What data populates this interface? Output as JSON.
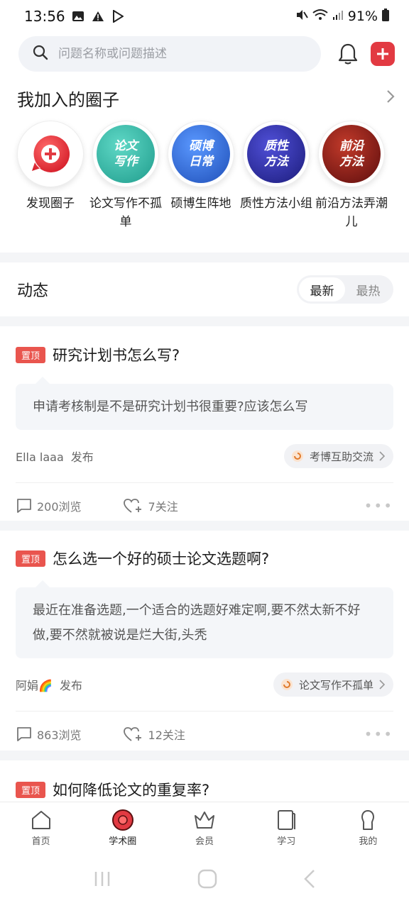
{
  "status_bar": {
    "time": "13:56",
    "battery": "91%"
  },
  "search": {
    "placeholder": "问题名称或问题描述"
  },
  "circles": {
    "title": "我加入的圈子",
    "items": [
      {
        "label": "发现圈子",
        "avatar_text": ""
      },
      {
        "label": "论文写作不孤单",
        "avatar_text": "论文写作",
        "color": "#2fb5a5"
      },
      {
        "label": "硕博生阵地",
        "avatar_text": "硕博日常",
        "color": "#2f6fd6"
      },
      {
        "label": "质性方法小组",
        "avatar_text": "质性方法",
        "color": "#2a2aa0"
      },
      {
        "label": "前沿方法弄潮儿",
        "avatar_text": "前沿方法",
        "color": "#8b1a1a"
      }
    ]
  },
  "feed": {
    "title": "动态",
    "tabs": [
      {
        "label": "最新",
        "active": true
      },
      {
        "label": "最热",
        "active": false
      }
    ],
    "posts": [
      {
        "pinned_label": "置顶",
        "title": "研究计划书怎么写?",
        "desc": "申请考核制是不是研究计划书很重要?应该怎么写",
        "author": "Ella laaa",
        "verb": "发布",
        "circle": "考博互助交流",
        "views": "200浏览",
        "follows": "7关注"
      },
      {
        "pinned_label": "置顶",
        "title": "怎么选一个好的硕士论文选题啊?",
        "desc": "最近在准备选题,一个适合的选题好难定啊,要不然太新不好做,要不然就被说是烂大街,头秃",
        "author": "阿娟🌈",
        "verb": "发布",
        "circle": "论文写作不孤单",
        "views": "863浏览",
        "follows": "12关注"
      },
      {
        "pinned_label": "置顶",
        "title": "如何降低论文的重复率?"
      }
    ]
  },
  "tabbar": {
    "items": [
      {
        "label": "首页"
      },
      {
        "label": "学术圈",
        "active": true
      },
      {
        "label": "会员"
      },
      {
        "label": "学习"
      },
      {
        "label": "我的"
      }
    ]
  },
  "colors": {
    "accent": "#e23a42",
    "pin": "#e9554e"
  }
}
